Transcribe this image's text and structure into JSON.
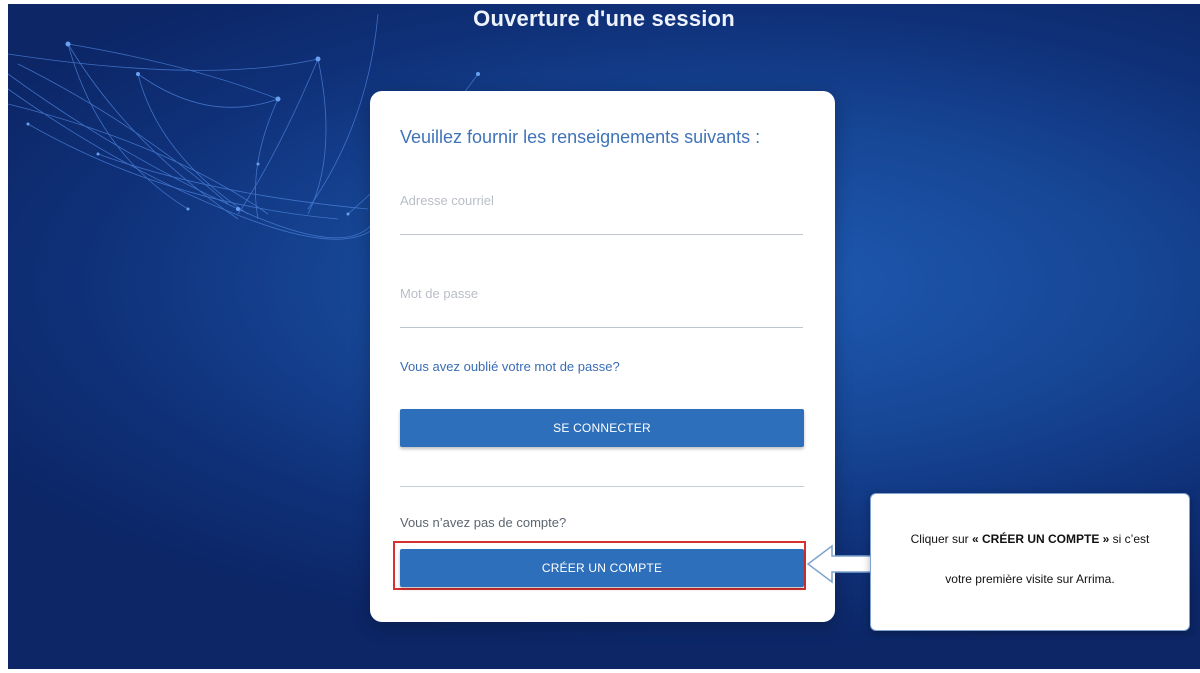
{
  "page": {
    "title": "Ouverture d'une session"
  },
  "login_card": {
    "heading": "Veuillez fournir les renseignements suivants :",
    "email_placeholder": "Adresse courriel",
    "password_placeholder": "Mot de passe",
    "forgot_password_link": "Vous avez oublié votre mot de passe?",
    "login_button": "SE CONNECTER",
    "no_account_text": "Vous n’avez pas de compte?",
    "create_account_button": "CRÉER UN COMPTE"
  },
  "callout": {
    "line1_prefix": "Cliquer sur ",
    "line1_emphasis": "« CRÉER UN COMPTE »",
    "line1_suffix": " si c’est",
    "line2": "votre première visite sur Arrima."
  },
  "colors": {
    "background": "#164594",
    "primary_button": "#2d6fba",
    "heading_text": "#3f73b8",
    "highlight_border": "#d63030"
  }
}
